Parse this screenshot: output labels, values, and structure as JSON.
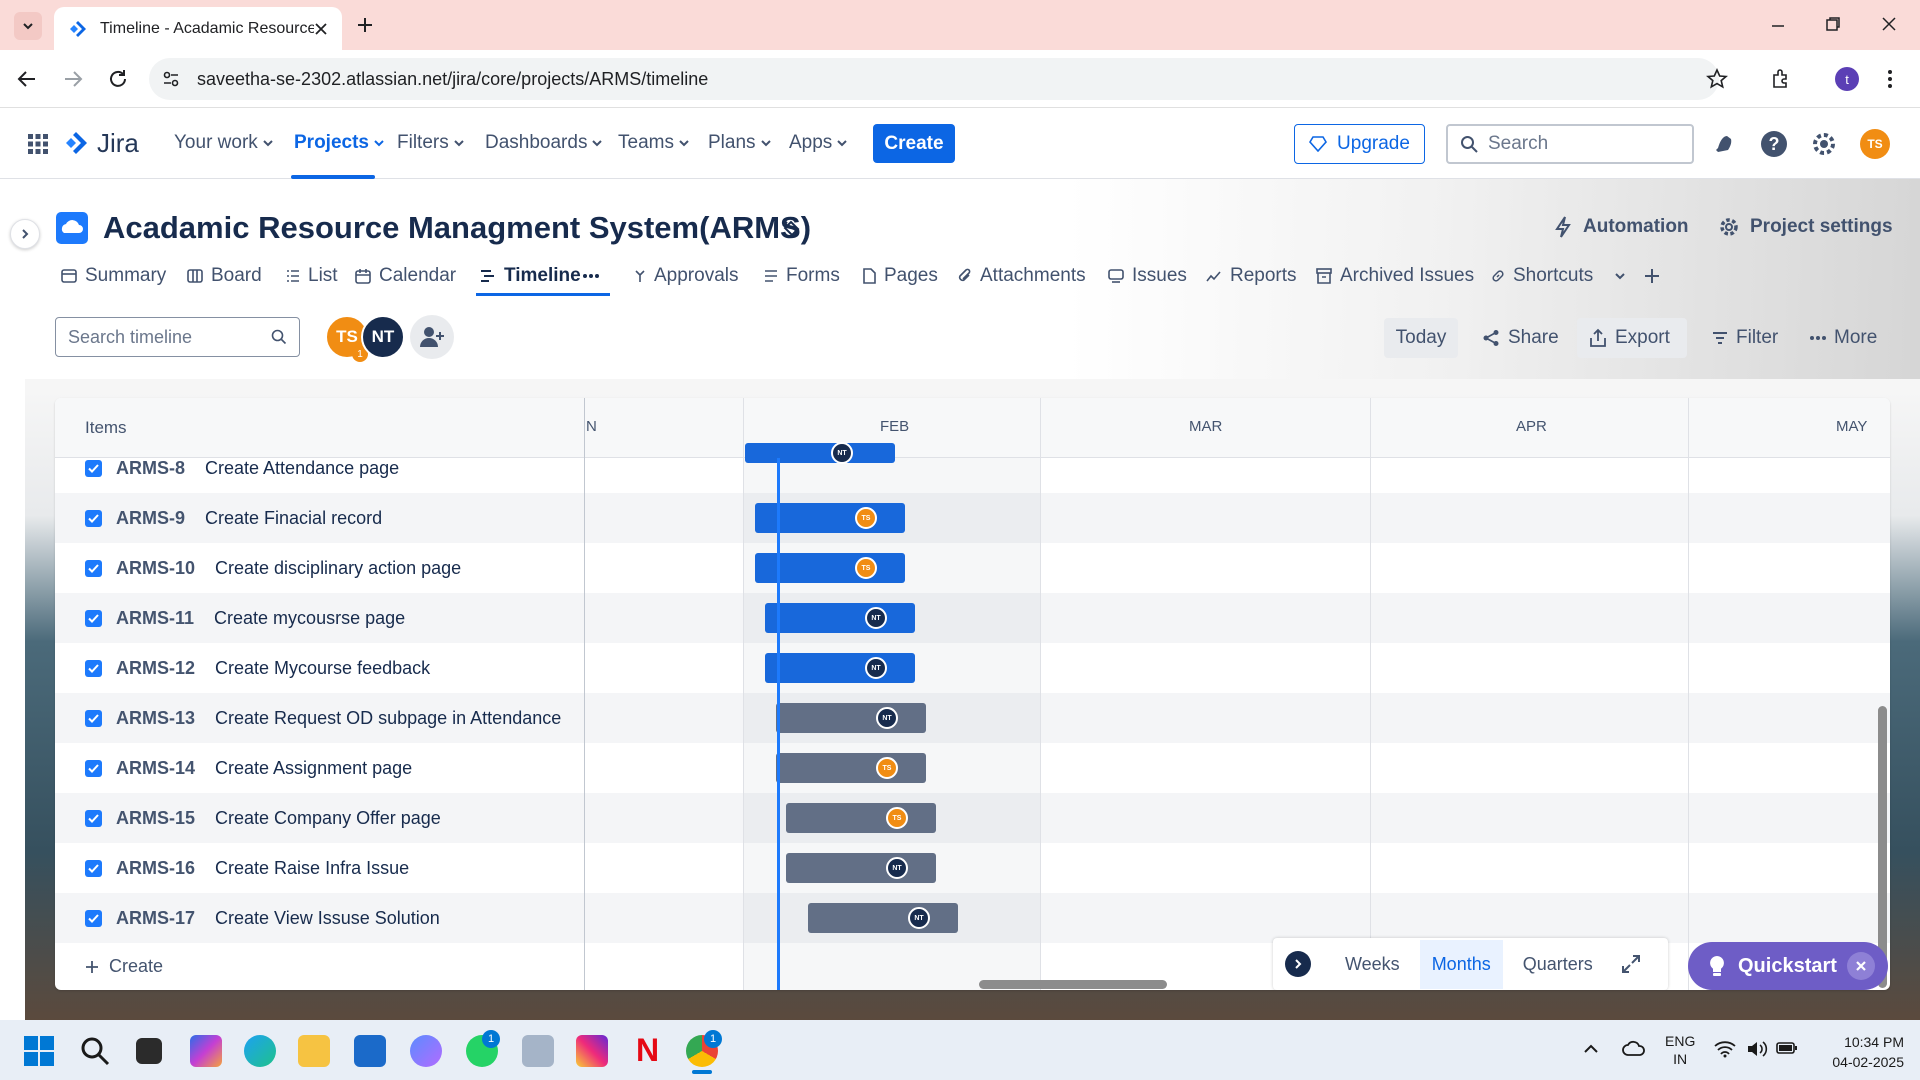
{
  "browser": {
    "tab_title": "Timeline - Acadamic Resource M",
    "url": "saveetha-se-2302.atlassian.net/jira/core/projects/ARMS/timeline",
    "profile_initial": "t"
  },
  "jira_nav": {
    "logo_text": "Jira",
    "items": [
      "Your work",
      "Projects",
      "Filters",
      "Dashboards",
      "Teams",
      "Plans",
      "Apps"
    ],
    "create": "Create",
    "upgrade": "Upgrade",
    "search_placeholder": "Search",
    "user_initials": "TS"
  },
  "project": {
    "title": "Acadamic Resource Managment System(ARMS)",
    "automation": "Automation",
    "settings": "Project settings",
    "tabs": [
      "Summary",
      "Board",
      "List",
      "Calendar",
      "Timeline",
      "Approvals",
      "Forms",
      "Pages",
      "Attachments",
      "Issues",
      "Reports",
      "Archived Issues",
      "Shortcuts"
    ]
  },
  "toolbar": {
    "search_placeholder": "Search timeline",
    "avatar1": "TS",
    "avatar1_badge": "1",
    "avatar2": "NT",
    "today": "Today",
    "share": "Share",
    "export": "Export",
    "filter": "Filter",
    "more": "More"
  },
  "timeline": {
    "items_header": "Items",
    "months": [
      "N",
      "FEB",
      "MAR",
      "APR",
      "MAY"
    ],
    "create_label": "Create",
    "rows": [
      {
        "key": "ARMS-8",
        "summary": "Create Attendance page",
        "assignee": "NT",
        "status": "blue"
      },
      {
        "key": "ARMS-9",
        "summary": "Create Finacial record",
        "assignee": "TS",
        "status": "blue"
      },
      {
        "key": "ARMS-10",
        "summary": "Create disciplinary action page",
        "assignee": "TS",
        "status": "blue"
      },
      {
        "key": "ARMS-11",
        "summary": "Create mycousrse page",
        "assignee": "NT",
        "status": "blue"
      },
      {
        "key": "ARMS-12",
        "summary": "Create Mycourse feedback",
        "assignee": "NT",
        "status": "blue"
      },
      {
        "key": "ARMS-13",
        "summary": "Create Request OD subpage in Attendance",
        "assignee": "NT",
        "status": "grey"
      },
      {
        "key": "ARMS-14",
        "summary": "Create Assignment page",
        "assignee": "TS",
        "status": "grey"
      },
      {
        "key": "ARMS-15",
        "summary": "Create Company Offer page",
        "assignee": "TS",
        "status": "grey"
      },
      {
        "key": "ARMS-16",
        "summary": "Create Raise Infra Issue",
        "assignee": "NT",
        "status": "grey"
      },
      {
        "key": "ARMS-17",
        "summary": "Create View Issuse Solution",
        "assignee": "NT",
        "status": "grey"
      }
    ],
    "view_options": [
      "Weeks",
      "Months",
      "Quarters"
    ],
    "selected_view": "Months"
  },
  "quickstart": {
    "label": "Quickstart"
  },
  "taskbar": {
    "lang": "ENG",
    "region": "IN",
    "time": "10:34 PM",
    "date": "04-02-2025",
    "whatsapp_badge": "1",
    "chrome_badge": "1"
  },
  "colors": {
    "accent": "#0c66e4",
    "in_progress_bar": "#1868db",
    "todo_bar": "#626f86",
    "quickstart": "#6e5dc6"
  }
}
